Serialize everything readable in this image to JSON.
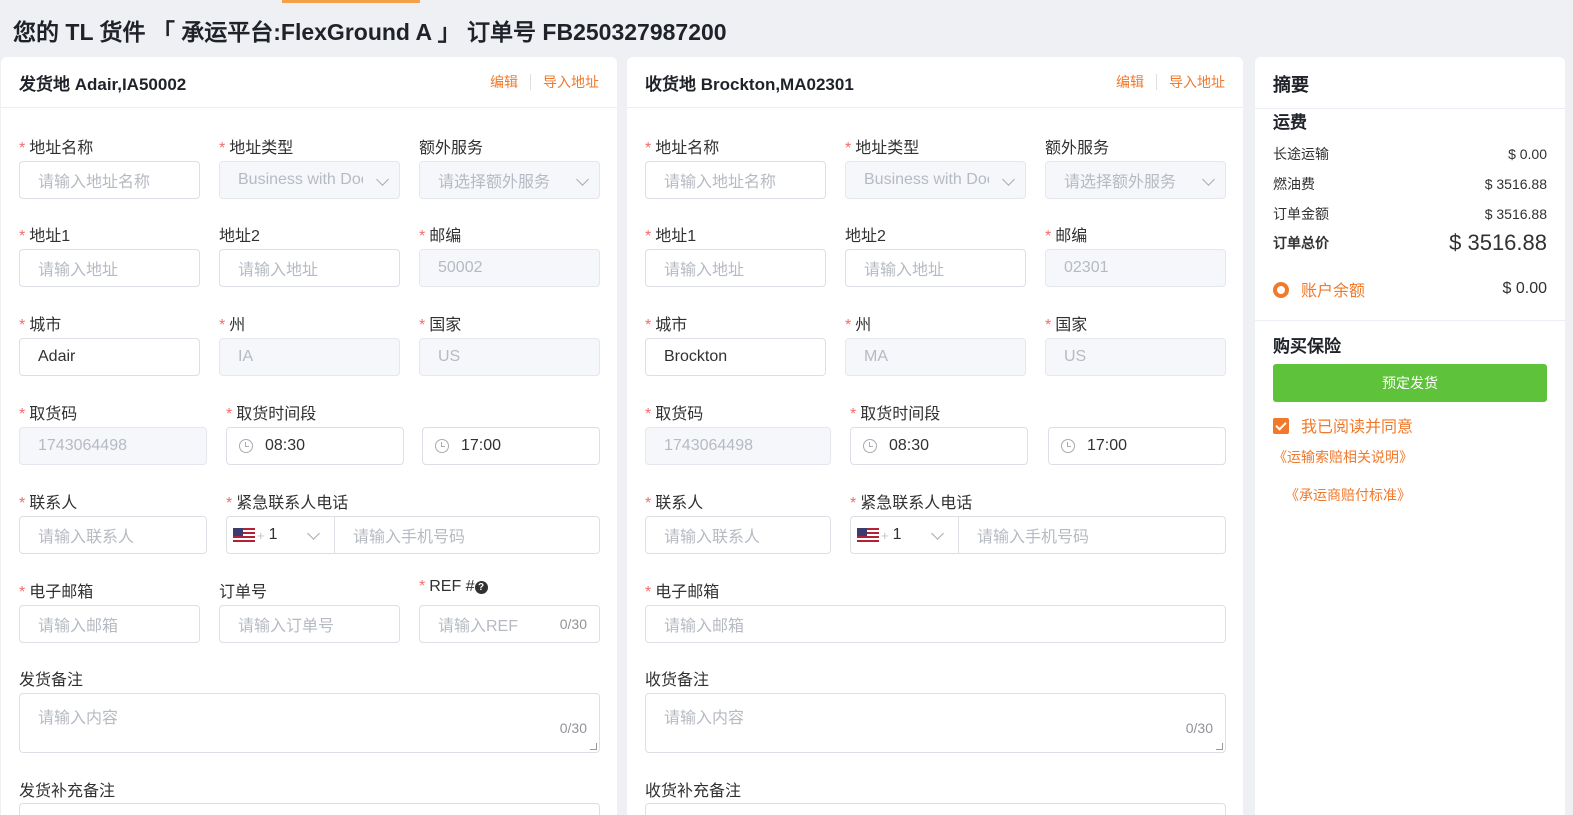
{
  "header": {
    "title": "您的 TL 货件 「 承运平台:FlexGround A 」 订单号 FB250327987200"
  },
  "common": {
    "edit": "编辑",
    "import_address": "导入地址",
    "address_name_label": "地址名称",
    "address_name_ph": "请输入地址名称",
    "address_type_label": "地址类型",
    "address_type_value": "Business with Doc",
    "extra_service_label": "额外服务",
    "extra_service_ph": "请选择额外服务",
    "address1_label": "地址1",
    "address2_label": "地址2",
    "address_ph": "请输入地址",
    "zip_label": "邮编",
    "city_label": "城市",
    "state_label": "州",
    "country_label": "国家",
    "pickup_code_label": "取货码",
    "time_window_label": "取货时间段",
    "contact_label": "联系人",
    "contact_ph": "请输入联系人",
    "emergency_phone_label": "紧急联系人电话",
    "phone_code": "1",
    "phone_plus": "+",
    "phone_ph": "请输入手机号码",
    "email_label": "电子邮箱",
    "email_ph": "请输入邮箱",
    "order_no_label": "订单号",
    "order_no_ph": "请输入订单号",
    "ref_label": "REF #",
    "ref_ph": "请输入REF",
    "counter": "0/30",
    "content_ph": "请输入内容",
    "help_glyph": "?"
  },
  "origin": {
    "title": "发货地 Adair,IA50002",
    "zip": "50002",
    "city": "Adair",
    "state": "IA",
    "country": "US",
    "pickup_code": "1743064498",
    "time_start": "08:30",
    "time_end": "17:00",
    "notes_label": "发货备注",
    "extra_notes_label": "发货补充备注"
  },
  "destination": {
    "title": "收货地 Brockton,MA02301",
    "zip": "02301",
    "city": "Brockton",
    "state": "MA",
    "country": "US",
    "pickup_code": "1743064498",
    "time_start": "08:30",
    "time_end": "17:00",
    "notes_label": "收货备注",
    "extra_notes_label": "收货补充备注"
  },
  "summary": {
    "title": "摘要",
    "freight_label": "运费",
    "rows": [
      {
        "label": "长途运输",
        "value": "$ 0.00"
      },
      {
        "label": "燃油费",
        "value": "$ 3516.88"
      },
      {
        "label": "订单金额",
        "value": "$ 3516.88"
      }
    ],
    "total_label": "订单总价",
    "total_value": "$ 3516.88",
    "balance_label": "账户余额",
    "balance_value": "$ 0.00",
    "insurance_label": "购买保险",
    "book_button": "预定发货",
    "agree_text": "我已阅读并同意",
    "link1": "《运输索赔相关说明》",
    "link2": "《承运商赔付标准》"
  },
  "colors": {
    "accent": "#f0792b",
    "primary_button": "#5ec23a",
    "required": "#f56c6c"
  }
}
